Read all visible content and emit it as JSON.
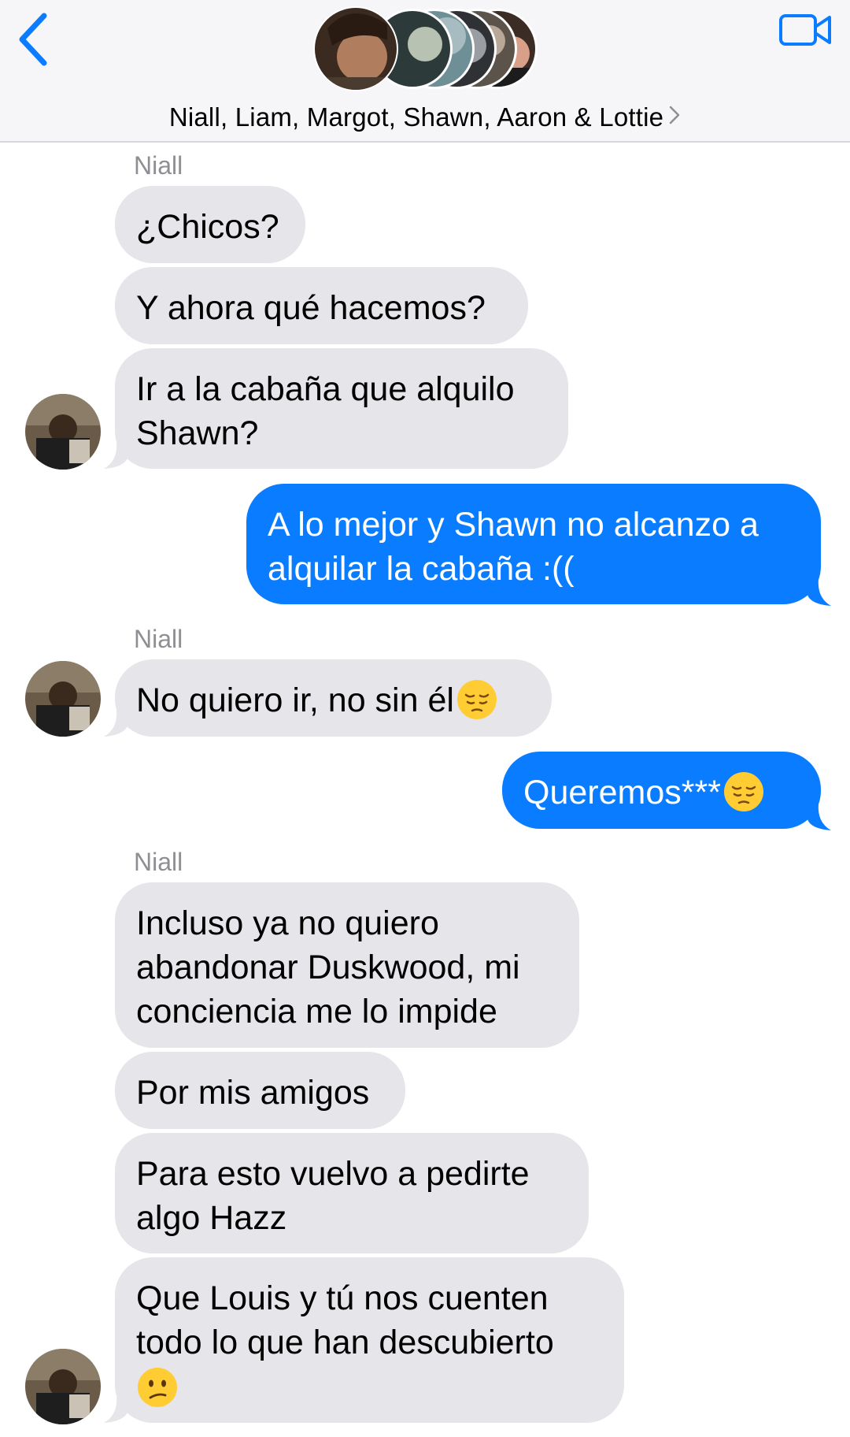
{
  "header": {
    "title": "Niall, Liam, Margot, Shawn, Aaron & Lottie",
    "back_icon": "chevron-left-icon",
    "video_icon": "video-camera-icon"
  },
  "colors": {
    "accent": "#0a7cff",
    "incoming_bubble": "#e5e5ea",
    "sender_name": "#8e8e93"
  },
  "messages": [
    {
      "sender": "Niall",
      "direction": "in",
      "text": "¿Chicos?"
    },
    {
      "direction": "in",
      "text": "Y ahora qué hacemos?"
    },
    {
      "direction": "in",
      "line1": "Ir a la cabaña que alquilo",
      "line2": "Shawn?"
    },
    {
      "direction": "out",
      "line1": "A lo mejor y Shawn no alcanzo a",
      "line2": "alquilar la cabaña :(("
    },
    {
      "sender": "Niall",
      "direction": "in",
      "text": "No quiero ir, no sin él",
      "emoji": "pensive-face-emoji"
    },
    {
      "direction": "out",
      "text": "Queremos***",
      "emoji": "pensive-face-emoji"
    },
    {
      "sender": "Niall",
      "direction": "in",
      "line1": "Incluso ya no quiero",
      "line2": "abandonar Duskwood, mi",
      "line3": "conciencia me lo impide"
    },
    {
      "direction": "in",
      "text": "Por mis amigos"
    },
    {
      "direction": "in",
      "line1": "Para esto vuelvo a pedirte",
      "line2": "algo Hazz"
    },
    {
      "direction": "in",
      "line1": "Que Louis y tú nos cuenten",
      "line2": "todo lo que han descubierto",
      "emoji": "confused-face-emoji"
    }
  ]
}
